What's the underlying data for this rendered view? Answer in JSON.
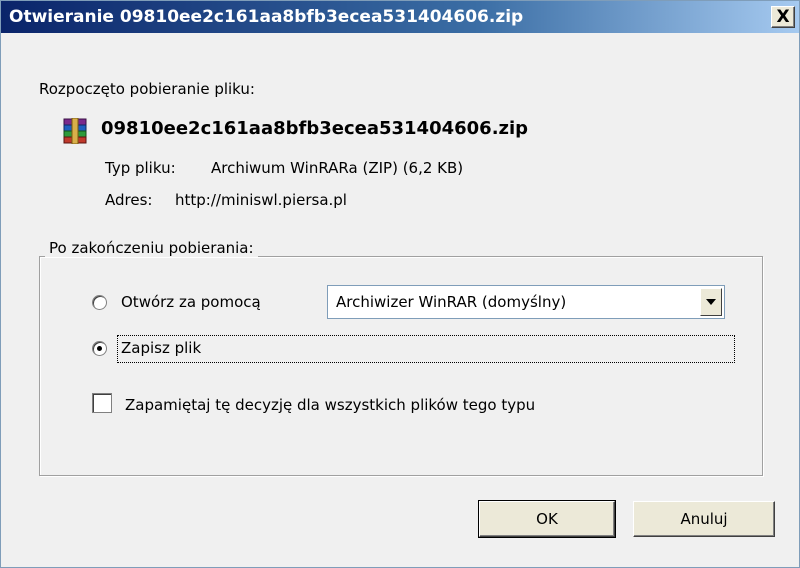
{
  "window": {
    "title": "Otwieranie 09810ee2c161aa8bfb3ecea531404606.zip",
    "close_label": "X"
  },
  "download": {
    "intro": "Rozpoczęto pobieranie pliku:",
    "file_icon": "winrar-archive-icon",
    "file_name": "09810ee2c161aa8bfb3ecea531404606.zip",
    "type_label": "Typ pliku:",
    "type_value": "Archiwum WinRARa (ZIP) (6,2 KB)",
    "address_label": "Adres:",
    "address_value": "http://miniswl.piersa.pl"
  },
  "options": {
    "group_label": "Po zakończeniu pobierania:",
    "open_with_label": "Otwórz za pomocą",
    "open_with_selected": false,
    "app_select_value": "Archiwizer WinRAR (domyślny)",
    "save_label": "Zapisz plik",
    "save_selected": true,
    "remember_label": "Zapamiętaj tę decyzję dla wszystkich plików tego typu",
    "remember_checked": false
  },
  "buttons": {
    "ok_label": "OK",
    "cancel_label": "Anuluj"
  },
  "colors": {
    "titlebar": "#0a246a",
    "face": "#f0f0f0"
  }
}
